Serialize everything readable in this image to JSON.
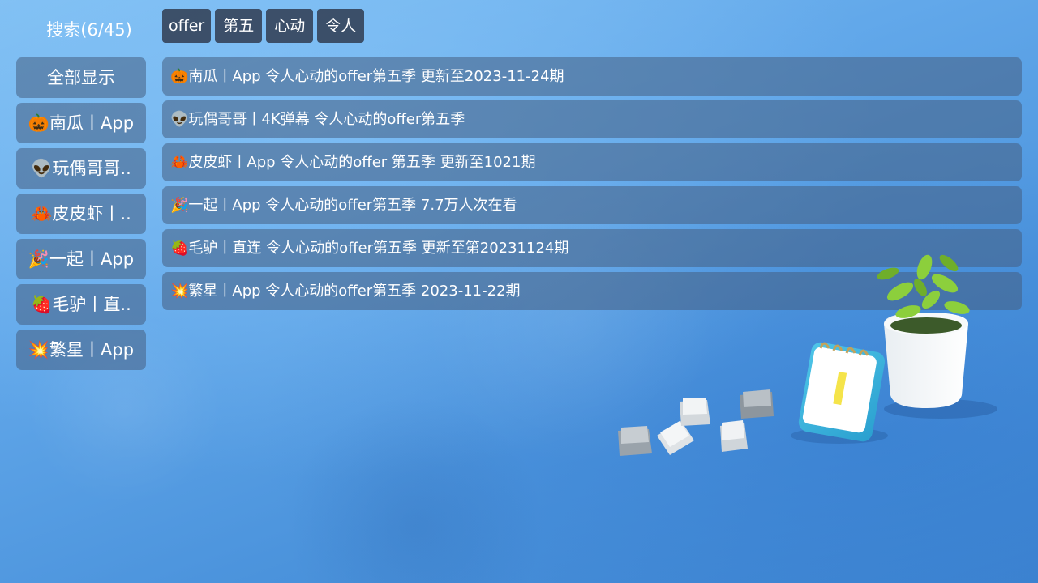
{
  "header": {
    "search_title": "搜索(6/45)"
  },
  "keywords": [
    "offer",
    "第五",
    "心动",
    "令人"
  ],
  "sidebar": {
    "items": [
      {
        "label": "全部显示"
      },
      {
        "label": "🎃南瓜丨App"
      },
      {
        "label": "👽玩偶哥哥.."
      },
      {
        "label": "🦀皮皮虾丨.."
      },
      {
        "label": "🎉一起丨App"
      },
      {
        "label": "🍓毛驴丨直.."
      },
      {
        "label": "💥繁星丨App"
      }
    ]
  },
  "results": [
    {
      "text": "🎃南瓜丨App  令人心动的offer第五季  更新至2023-11-24期"
    },
    {
      "text": "👽玩偶哥哥丨4K弹幕  令人心动的offer第五季"
    },
    {
      "text": "🦀皮皮虾丨App  令人心动的offer 第五季  更新至1021期"
    },
    {
      "text": "🎉一起丨App  令人心动的offer第五季  7.7万人次在看"
    },
    {
      "text": "🍓毛驴丨直连  令人心动的offer第五季  更新至第20231124期"
    },
    {
      "text": "💥繁星丨App  令人心动的offer第五季  2023-11-22期"
    }
  ]
}
